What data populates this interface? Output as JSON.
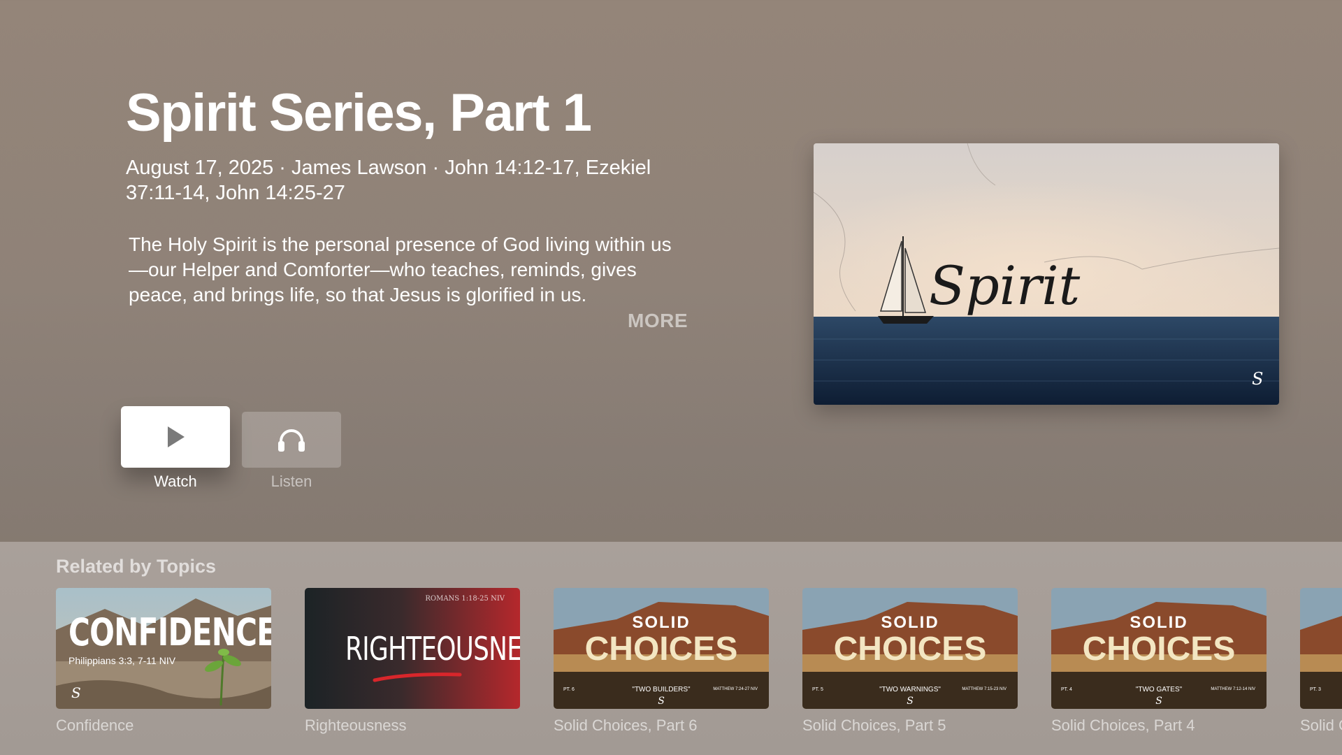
{
  "hero": {
    "title": "Spirit Series, Part 1",
    "meta_line1": "August 17, 2025 · James Lawson · John 14:12-17, Ezekiel",
    "meta_line2": "37:11-14, John 14:25-27",
    "description": "The Holy Spirit is the personal presence of God living within us—our Helper and Comforter—who teaches, reminds, gives peace, and brings life, so that Jesus is glorified in us.",
    "more_label": "MORE",
    "artwork_text": "Spirit",
    "artwork_mark": "S"
  },
  "buttons": {
    "watch_label": "Watch",
    "watch_icon": "play-icon",
    "listen_label": "Listen",
    "listen_icon": "headphones-icon"
  },
  "related": {
    "heading": "Related by Topics",
    "items": [
      {
        "label": "Confidence",
        "thumb_title": "CONFIDENCE",
        "thumb_sub": "Philippians 3:3, 7-11 NIV",
        "thumb_mark": "S"
      },
      {
        "label": "Righteousness",
        "thumb_title": "RIGHTEOUSNESS",
        "thumb_ref": "ROMANS 1:18-25 NIV"
      },
      {
        "label": "Solid Choices, Part 6",
        "thumb_top": "SOLID",
        "thumb_title": "CHOICES",
        "thumb_part": "PT. 6",
        "thumb_quote": "\"TWO BUILDERS\"",
        "thumb_ref": "MATTHEW 7:24-27 NIV",
        "thumb_mark": "S"
      },
      {
        "label": "Solid Choices, Part 5",
        "thumb_top": "SOLID",
        "thumb_title": "CHOICES",
        "thumb_part": "PT. 5",
        "thumb_quote": "\"TWO WARNINGS\"",
        "thumb_ref": "MATTHEW 7:15-23 NIV",
        "thumb_mark": "S"
      },
      {
        "label": "Solid Choices, Part 4",
        "thumb_top": "SOLID",
        "thumb_title": "CHOICES",
        "thumb_part": "PT. 4",
        "thumb_quote": "\"TWO GATES\"",
        "thumb_ref": "MATTHEW 7:12-14 NIV",
        "thumb_mark": "S"
      },
      {
        "label": "Solid C",
        "thumb_part": "PT. 3"
      }
    ]
  }
}
